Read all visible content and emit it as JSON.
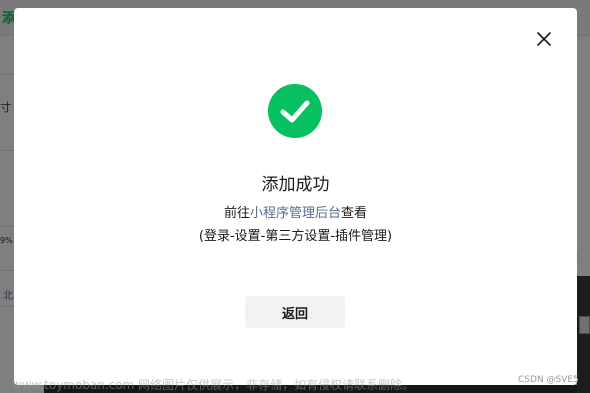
{
  "background": {
    "title_fragment": "添",
    "text_fragment": "寸",
    "percent_fragment": "9%",
    "link_fragment": "北",
    "arrow_glyph": "‹"
  },
  "dialog": {
    "title": "添加成功",
    "line1_prefix": "前往",
    "line1_link": "小程序管理后台",
    "line1_suffix": "查看",
    "line2": "(登录-设置-第三方设置-插件管理)",
    "back_label": "返回",
    "icons": {
      "close": "close-icon",
      "success": "check-circle-icon"
    },
    "colors": {
      "success": "#07c160",
      "link": "#576b95"
    }
  },
  "watermark": {
    "text": "www.toymoban.com 网络图片仅供展示，非存储，如有侵权请联系删除。",
    "csdn": "CSDN @SVE5"
  }
}
